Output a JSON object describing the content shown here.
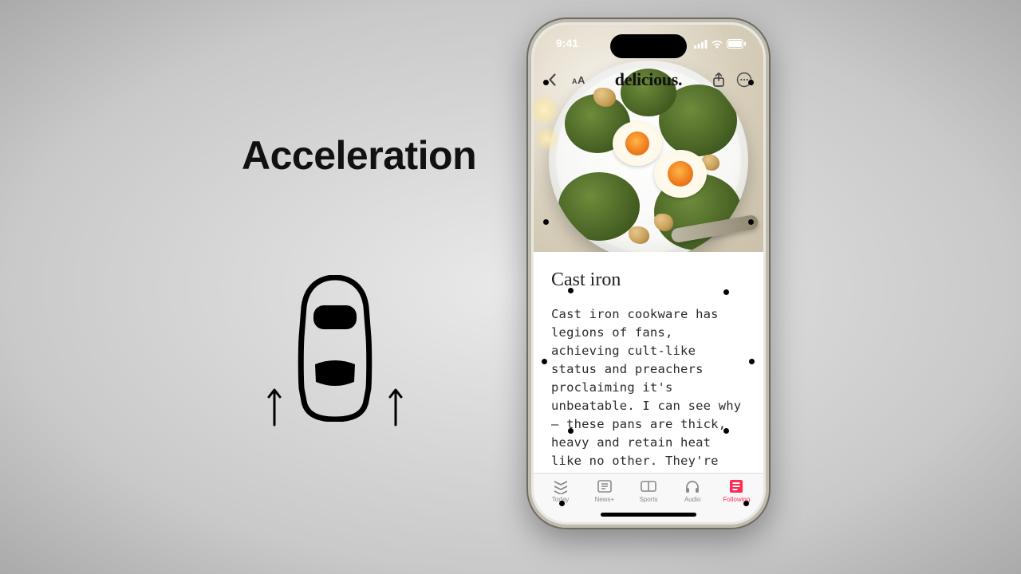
{
  "slide": {
    "heading": "Acceleration",
    "car_icon": "car-top-icon",
    "arrow_icon": "arrow-up-icon"
  },
  "phone": {
    "status": {
      "time": "9:41"
    },
    "topbar": {
      "title": "delicious.",
      "back_icon": "chevron-left-icon",
      "text_size_icon": "text-size-icon",
      "share_icon": "share-icon",
      "more_icon": "ellipsis-icon"
    },
    "article": {
      "title": "Cast iron",
      "body": "Cast iron cookware has legions of fans, achieving cult-like status and preachers proclaiming it's unbeatable. I can see why – these pans are thick, heavy and retain heat like no other. They're unmatched for meat that needs a strong sear: hav-"
    },
    "tabs": [
      {
        "id": "today",
        "label": "Today",
        "icon": "news-icon",
        "active": false
      },
      {
        "id": "newsplus",
        "label": "News+",
        "icon": "newsplus-icon",
        "active": false
      },
      {
        "id": "sports",
        "label": "Sports",
        "icon": "scoreboard-icon",
        "active": false
      },
      {
        "id": "audio",
        "label": "Audio",
        "icon": "headphones-icon",
        "active": false
      },
      {
        "id": "following",
        "label": "Following",
        "icon": "following-icon",
        "active": true
      }
    ]
  }
}
